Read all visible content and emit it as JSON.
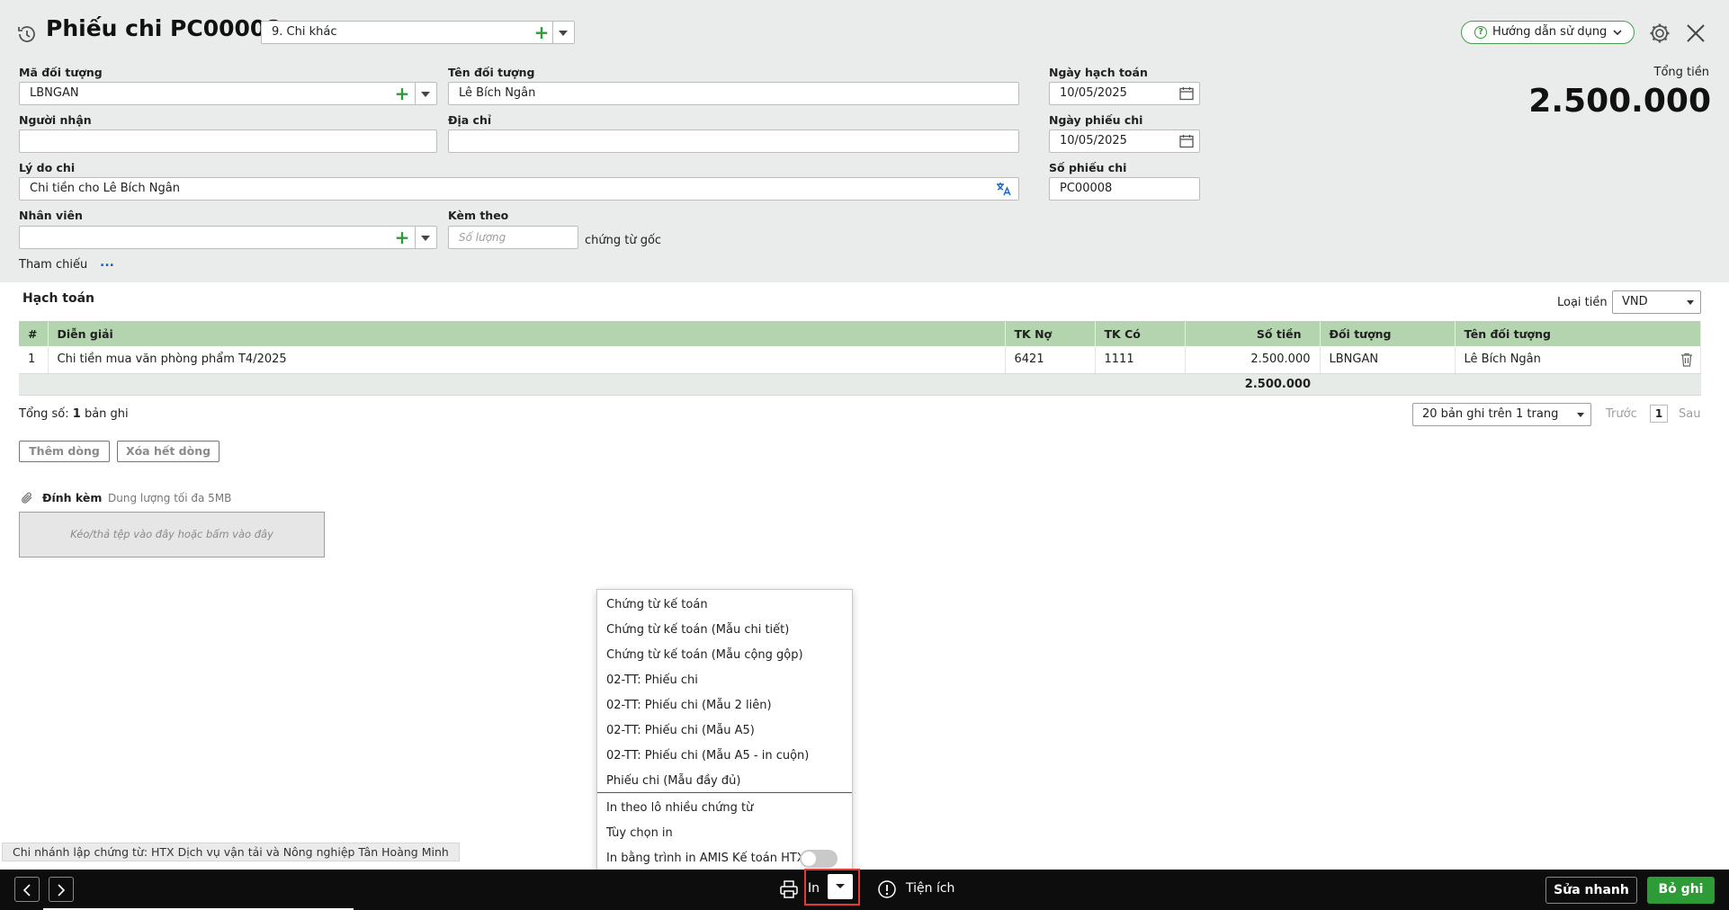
{
  "header": {
    "title": "Phiếu chi PC00008",
    "type_value": "9. Chi khác",
    "guide_label": "Hướng dẫn sử dụng",
    "total_label": "Tổng tiền",
    "total_value": "2.500.000"
  },
  "form": {
    "object_code_label": "Mã đối tượng",
    "object_code_value": "LBNGAN",
    "object_name_label": "Tên đối tượng",
    "object_name_value": "Lê Bích Ngân",
    "receiver_label": "Người nhận",
    "receiver_value": "",
    "address_label": "Địa chỉ",
    "address_value": "",
    "reason_label": "Lý do chi",
    "reason_value": "Chi tiền cho Lê Bích Ngân",
    "employee_label": "Nhân viên",
    "employee_value": "",
    "attach_label": "Kèm theo",
    "attach_placeholder": "Số lượng",
    "attach_suffix": "chứng từ gốc",
    "reference_label": "Tham chiếu",
    "reference_link": "...",
    "posting_date_label": "Ngày hạch toán",
    "posting_date_value": "10/05/2025",
    "voucher_date_label": "Ngày phiếu chi",
    "voucher_date_value": "10/05/2025",
    "voucher_no_label": "Số phiếu chi",
    "voucher_no_value": "PC00008"
  },
  "accounting": {
    "section_title": "Hạch toán",
    "currency_label": "Loại tiền",
    "currency_value": "VND",
    "columns": [
      "#",
      "Diễn giải",
      "TK Nợ",
      "TK Có",
      "Số tiền",
      "Đối tượng",
      "Tên đối tượng"
    ],
    "rows": [
      {
        "no": "1",
        "desc": "Chi tiền mua văn phòng phẩm T4/2025",
        "debit": "6421",
        "credit": "1111",
        "amount": "2.500.000",
        "object": "LBNGAN",
        "object_name": "Lê Bích Ngân"
      }
    ],
    "sum_amount": "2.500.000",
    "count_prefix": "Tổng số:",
    "count_value": "1",
    "count_suffix": "bản ghi",
    "page_size": "20 bản ghi trên 1 trang",
    "prev": "Trước",
    "page": "1",
    "next": "Sau",
    "add_row": "Thêm dòng",
    "delete_rows": "Xóa hết dòng"
  },
  "attachments": {
    "label": "Đính kèm",
    "hint": "Dung lượng tối đa 5MB",
    "dropzone": "Kéo/thả tệp vào đây hoặc bấm vào đây"
  },
  "print_menu": {
    "items": [
      "Chứng từ kế toán",
      "Chứng từ kế toán (Mẫu chi tiết)",
      "Chứng từ kế toán (Mẫu cộng gộp)",
      "02-TT: Phiếu chi",
      "02-TT: Phiếu chi (Mẫu 2 liên)",
      "02-TT: Phiếu chi (Mẫu A5)",
      "02-TT: Phiếu chi (Mẫu A5 - in cuộn)",
      "Phiếu chi (Mẫu đầy đủ)"
    ],
    "extra_items": [
      "In theo lô nhiều chứng từ",
      "Tùy chọn in",
      "In bằng trình in AMIS Kế toán HTX"
    ],
    "toggle_on": false
  },
  "branch": "Chi nhánh lập chứng từ: HTX Dịch vụ vận tải và Nông nghiệp Tân Hoàng Minh",
  "footer": {
    "print_label": "In",
    "utilities_label": "Tiện ích",
    "quick_edit": "Sửa nhanh",
    "save": "Bỏ ghi"
  },
  "colors": {
    "accent_green": "#2e9c36",
    "grid_header": "#b3d4ae",
    "highlight_red": "#e53935"
  }
}
